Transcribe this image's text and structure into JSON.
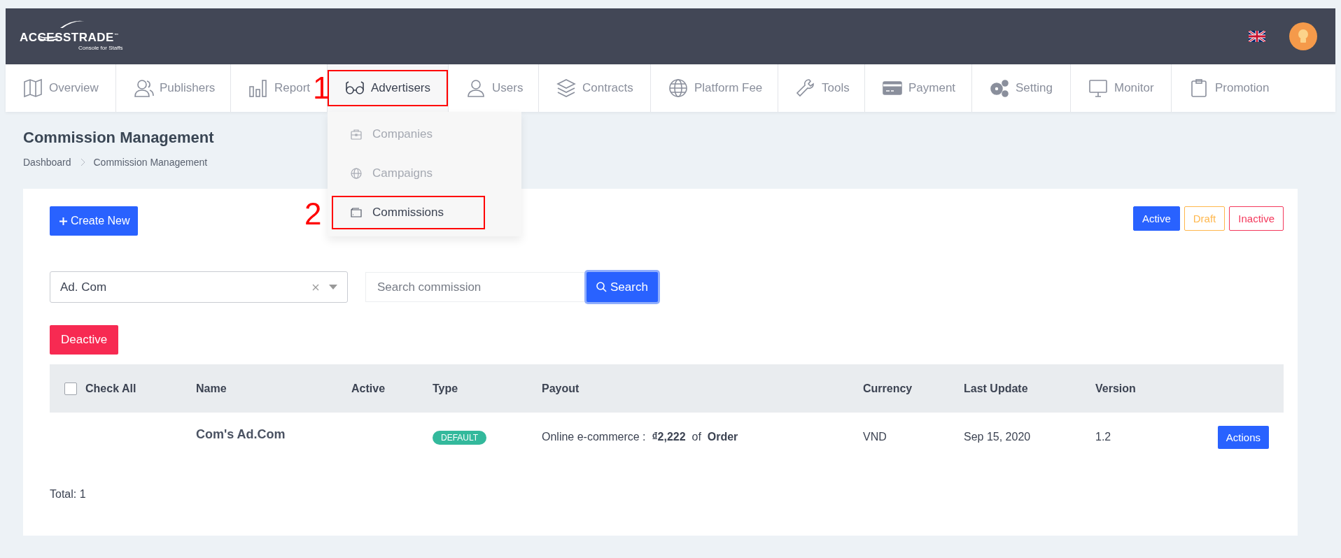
{
  "header": {
    "logo": {
      "name": "ACCESSTRADE",
      "trademark": "™",
      "tagline": "Console for Staffs"
    }
  },
  "nav": [
    {
      "label": "Overview",
      "selected": false,
      "annotated": false
    },
    {
      "label": "Publishers",
      "selected": false,
      "annotated": false
    },
    {
      "label": "Report",
      "selected": false,
      "annotated": false
    },
    {
      "label": "Advertisers",
      "selected": true,
      "annotated": true,
      "marker": "1"
    },
    {
      "label": "Users",
      "selected": false,
      "annotated": false
    },
    {
      "label": "Contracts",
      "selected": false,
      "annotated": false
    },
    {
      "label": "Platform Fee",
      "selected": false,
      "annotated": false
    },
    {
      "label": "Tools",
      "selected": false,
      "annotated": false
    },
    {
      "label": "Payment",
      "selected": false,
      "annotated": false
    },
    {
      "label": "Setting",
      "selected": false,
      "annotated": false
    },
    {
      "label": "Monitor",
      "selected": false,
      "annotated": false
    },
    {
      "label": "Promotion",
      "selected": false,
      "annotated": false
    }
  ],
  "dropdown": {
    "items": [
      {
        "label": "Companies",
        "selected": false,
        "annotated": false
      },
      {
        "label": "Campaigns",
        "selected": false,
        "annotated": false
      },
      {
        "label": "Commissions",
        "selected": true,
        "annotated": true,
        "marker": "2"
      }
    ]
  },
  "page": {
    "title": "Commission Management",
    "breadcrumb": [
      "Dashboard",
      "Commission Management"
    ]
  },
  "create_button": "Create New",
  "status_filters": [
    {
      "label": "Active",
      "selected": true,
      "color": "#2962ff"
    },
    {
      "label": "Draft",
      "selected": false,
      "color": "#ffb74d"
    },
    {
      "label": "Inactive",
      "selected": false,
      "color": "#f4395c"
    }
  ],
  "advertiser_select": {
    "value": "Ad. Com"
  },
  "search": {
    "placeholder": "Search commission",
    "button": "Search"
  },
  "deactive_button": "Deactive",
  "table": {
    "check_all": {
      "label": "Check All",
      "checked": false
    },
    "columns": [
      "Name",
      "Active",
      "Type",
      "Payout",
      "Currency",
      "Last Update",
      "Version"
    ],
    "rows": [
      {
        "name": "Com's Ad.Com",
        "type": "DEFAULT",
        "payout": "Online e-commerce :  **₫2,222**  of  **Order**",
        "currency": "VND",
        "last_update": "Sep 15, 2020",
        "version": "1.2",
        "action": "Actions"
      }
    ]
  },
  "total": "Total: 1"
}
